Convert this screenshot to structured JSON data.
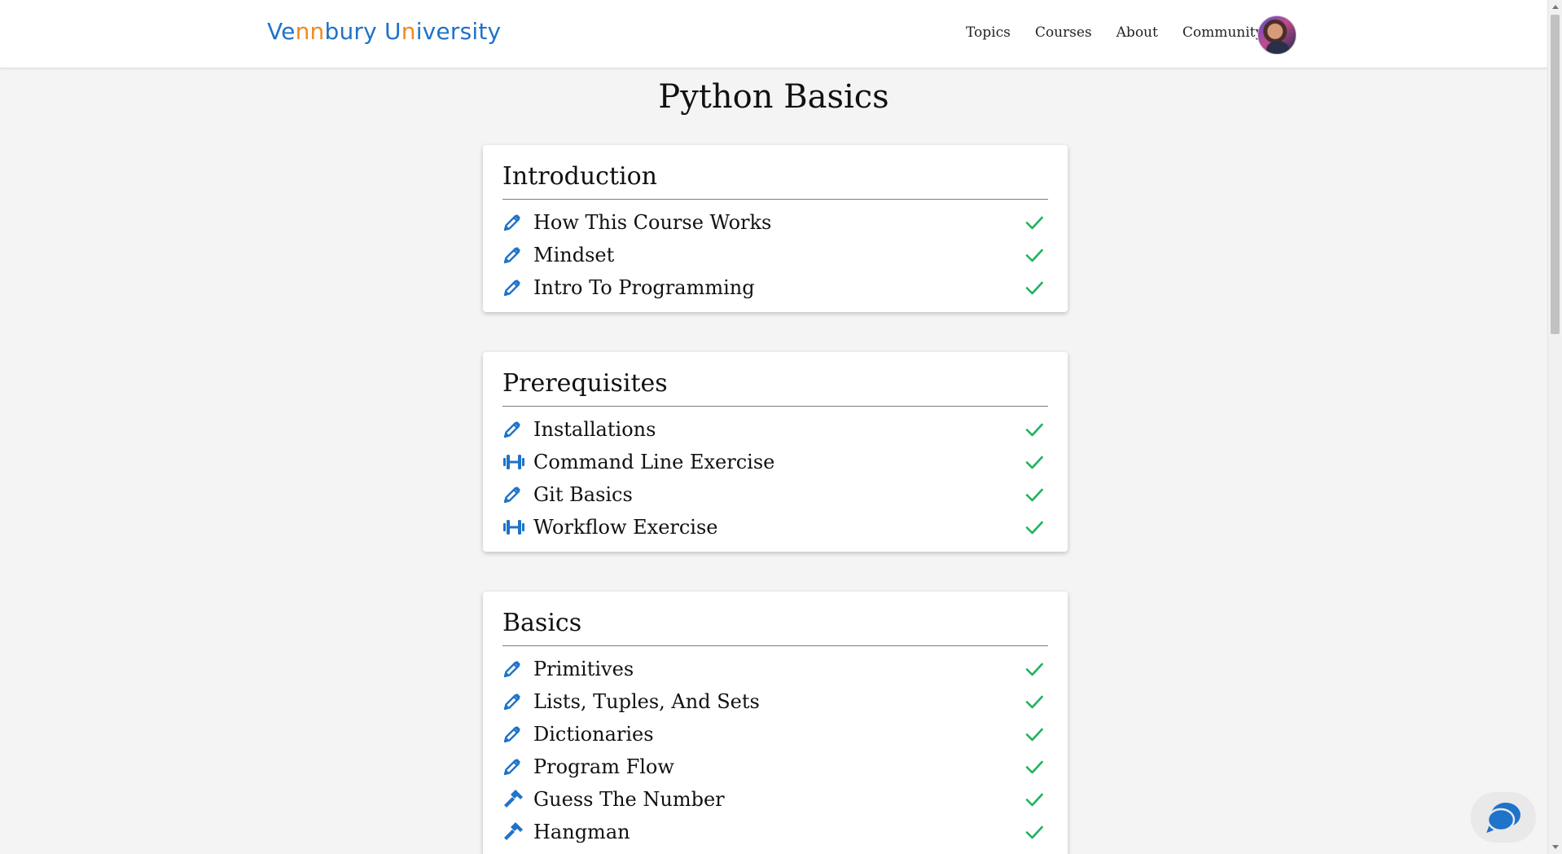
{
  "header": {
    "logo": {
      "parts": [
        {
          "text": "Ve",
          "color": "#1f73c9"
        },
        {
          "text": "nn",
          "color": "#f08a1f"
        },
        {
          "text": "bury ",
          "color": "#1f73c9"
        },
        {
          "text": "U",
          "color": "#1f73c9"
        },
        {
          "text": "n",
          "color": "#f08a1f"
        },
        {
          "text": "iversity",
          "color": "#1f73c9"
        }
      ]
    },
    "nav": [
      "Topics",
      "Courses",
      "About",
      "Community"
    ]
  },
  "page_title": "Python Basics",
  "sections": [
    {
      "title": "Introduction",
      "lessons": [
        {
          "label": "How This Course Works",
          "icon": "pencil-icon",
          "completed": true
        },
        {
          "label": "Mindset",
          "icon": "pencil-icon",
          "completed": true
        },
        {
          "label": "Intro To Programming",
          "icon": "pencil-icon",
          "completed": true
        }
      ]
    },
    {
      "title": "Prerequisites",
      "lessons": [
        {
          "label": "Installations",
          "icon": "pencil-icon",
          "completed": true
        },
        {
          "label": "Command Line Exercise",
          "icon": "dumbbell-icon",
          "completed": true
        },
        {
          "label": "Git Basics",
          "icon": "pencil-icon",
          "completed": true
        },
        {
          "label": "Workflow Exercise",
          "icon": "dumbbell-icon",
          "completed": true
        }
      ]
    },
    {
      "title": "Basics",
      "lessons": [
        {
          "label": "Primitives",
          "icon": "pencil-icon",
          "completed": true
        },
        {
          "label": "Lists, Tuples, And Sets",
          "icon": "pencil-icon",
          "completed": true
        },
        {
          "label": "Dictionaries",
          "icon": "pencil-icon",
          "completed": true
        },
        {
          "label": "Program Flow",
          "icon": "pencil-icon",
          "completed": true
        },
        {
          "label": "Guess The Number",
          "icon": "hammer-icon",
          "completed": true
        },
        {
          "label": "Hangman",
          "icon": "hammer-icon",
          "completed": true
        }
      ]
    }
  ],
  "colors": {
    "accent_blue": "#1f73c9",
    "accent_orange": "#f08a1f",
    "check_green": "#1fb35e",
    "icon_blue": "#1f73c9"
  }
}
